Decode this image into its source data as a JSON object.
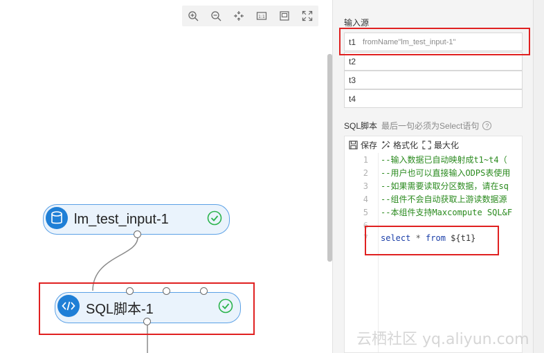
{
  "canvas": {
    "toolbar": [
      {
        "name": "zoom-in-icon"
      },
      {
        "name": "zoom-out-icon"
      },
      {
        "name": "fit-to-screen-icon"
      },
      {
        "name": "actual-size-icon"
      },
      {
        "name": "minimap-icon"
      },
      {
        "name": "fullscreen-icon"
      }
    ],
    "nodes": {
      "input": {
        "label": "lm_test_input-1",
        "icon": "database-icon",
        "status": "success-check-icon"
      },
      "sql": {
        "label": "SQL脚本-1",
        "icon": "code-icon",
        "status": "success-check-icon"
      }
    }
  },
  "panel": {
    "input_title": "输入源",
    "inputs": [
      {
        "name": "t1",
        "value": "fromName\"lm_test_input-1\""
      },
      {
        "name": "t2",
        "value": ""
      },
      {
        "name": "t3",
        "value": ""
      },
      {
        "name": "t4",
        "value": ""
      }
    ],
    "sql_title": "SQL脚本",
    "sql_hint": "最后一句必须为Select语句",
    "help": "?",
    "editor": {
      "save_label": "保存",
      "format_label": "格式化",
      "maximize_label": "最大化",
      "lines": [
        {
          "n": "1",
          "text": "--输入数据已自动映射成t1~t4（"
        },
        {
          "n": "2",
          "text": "--用户也可以直接输入ODPS表使用"
        },
        {
          "n": "3",
          "text": "--如果需要读取分区数据，请在sq"
        },
        {
          "n": "4",
          "text": "--组件不会自动获取上游读数据源"
        },
        {
          "n": "5",
          "text": "--本组件支持Maxcompute SQL&F"
        },
        {
          "n": "6",
          "text": ""
        },
        {
          "n": "7",
          "kw1": "select",
          "op": " * ",
          "kw2": "from",
          "rest": " ${t1}"
        }
      ]
    }
  },
  "watermark": "云栖社区 yq.aliyun.com",
  "colors": {
    "accent": "#1f7fd6",
    "highlight": "#e02020",
    "success": "#2ab34b",
    "comment": "#2a8a1e"
  }
}
